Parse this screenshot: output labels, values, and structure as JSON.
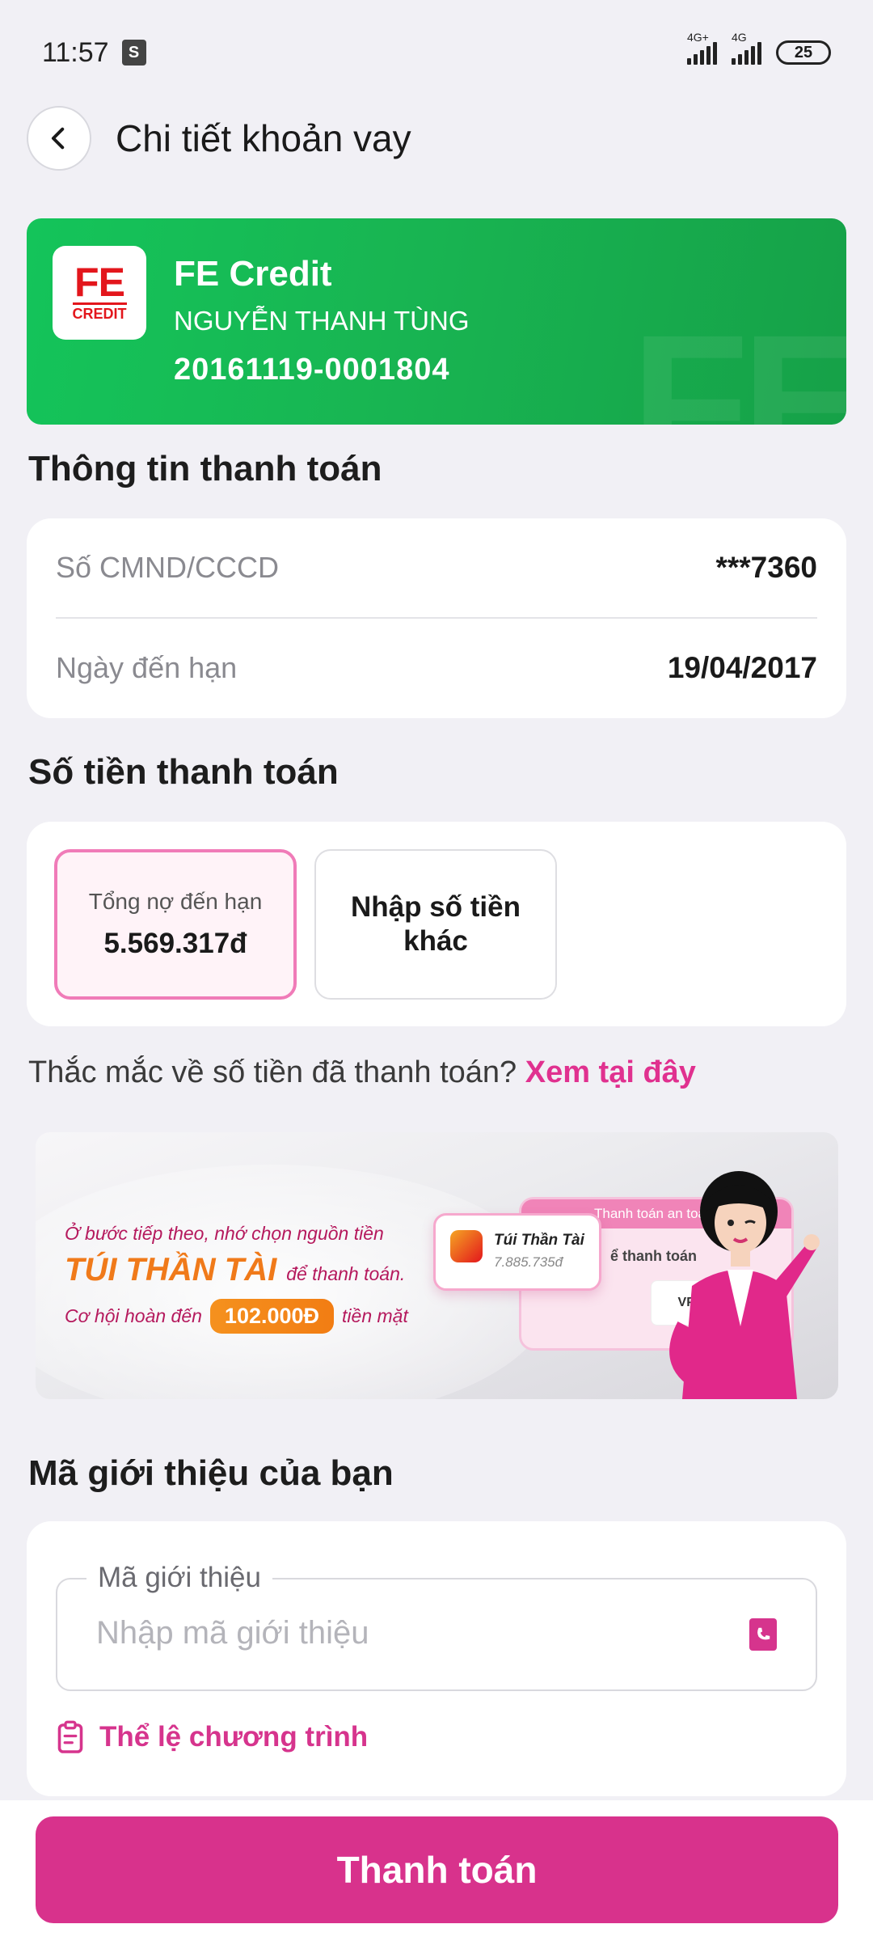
{
  "status_bar": {
    "time": "11:57",
    "net1": "4G+",
    "net2": "4G",
    "battery": "25"
  },
  "header": {
    "title": "Chi tiết khoản vay"
  },
  "loan": {
    "logo_top": "FE",
    "logo_bottom": "CREDIT",
    "provider": "FE Credit",
    "owner": "NGUYỄN THANH TÙNG",
    "contract_number": "20161119-0001804",
    "watermark": "FE"
  },
  "payment_info": {
    "title": "Thông tin thanh toán",
    "rows": [
      {
        "label": "Số CMND/CCCD",
        "value": "***7360"
      },
      {
        "label": "Ngày đến hạn",
        "value": "19/04/2017"
      }
    ]
  },
  "amount": {
    "title": "Số tiền thanh toán",
    "option_total_label": "Tổng nợ đến hạn",
    "option_total_value": "5.569.317đ",
    "option_other_label": "Nhập số tiền khác"
  },
  "question": {
    "text": "Thắc mắc về số tiền đã thanh toán?",
    "link": "Xem tại đây"
  },
  "promo": {
    "line1": "Ở bước tiếp theo, nhớ chọn nguồn tiền",
    "highlight": "TÚI THẦN TÀI",
    "line2_tail": "để thanh toán.",
    "line3_prefix": "Cơ hội hoàn đến",
    "badge": "102.000Đ",
    "line3_suffix": "tiền mặt",
    "screen_title": "Thanh toán an toàn",
    "screen_row": "ể thanh toán",
    "bank": "VPB",
    "wallet_name": "Túi Thần Tài",
    "wallet_balance": "7.885.735đ"
  },
  "referral": {
    "title": "Mã giới thiệu của bạn",
    "field_label": "Mã giới thiệu",
    "placeholder": "Nhập mã giới thiệu",
    "rules_link": "Thể lệ chương trình"
  },
  "footer": {
    "pay_button": "Thanh toán"
  },
  "colors": {
    "primary": "#d8328c",
    "green_card": "#16b552",
    "fe_red": "#e3161c",
    "promo_orange": "#f07a1a"
  }
}
